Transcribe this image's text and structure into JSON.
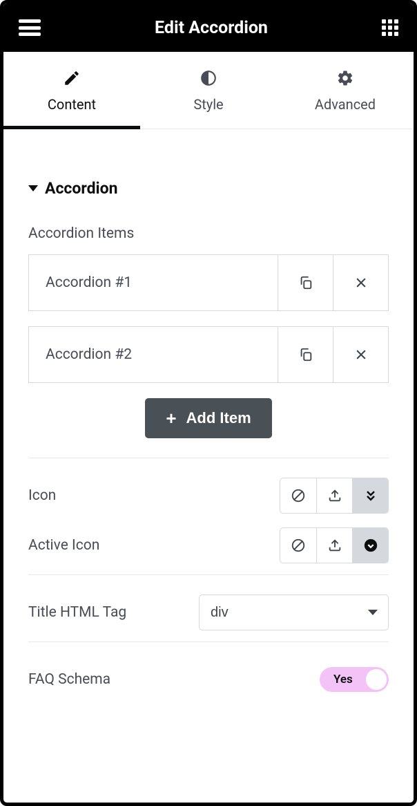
{
  "header": {
    "title": "Edit Accordion"
  },
  "tabs": {
    "content": "Content",
    "style": "Style",
    "advanced": "Advanced"
  },
  "section": {
    "title": "Accordion"
  },
  "accordion_items": {
    "label": "Accordion Items",
    "items": [
      {
        "title": "Accordion #1"
      },
      {
        "title": "Accordion #2"
      }
    ],
    "add_button": "Add Item"
  },
  "icon_control": {
    "label": "Icon"
  },
  "active_icon_control": {
    "label": "Active Icon"
  },
  "html_tag": {
    "label": "Title HTML Tag",
    "value": "div"
  },
  "faq_schema": {
    "label": "FAQ Schema",
    "value": "Yes"
  }
}
